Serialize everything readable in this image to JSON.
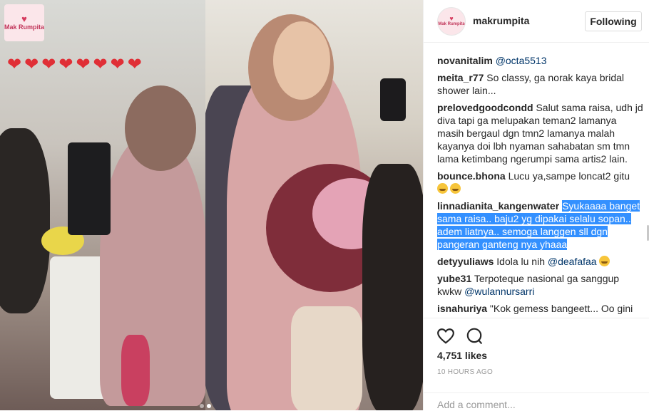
{
  "media": {
    "watermark_text": "Mak Rumpita",
    "hearts": [
      "❤",
      "❤",
      "❤",
      "❤",
      "❤",
      "❤",
      "❤",
      "❤"
    ],
    "carousel": {
      "count": 2,
      "active": 1
    }
  },
  "header": {
    "avatar_text": "Mak Rumpita",
    "username": "makrumpita",
    "follow_label": "Following"
  },
  "comments": [
    {
      "user": "novanitalim",
      "parts": [
        {
          "t": "mention",
          "v": "@octa5513"
        }
      ]
    },
    {
      "user": "meita_r77",
      "parts": [
        {
          "t": "text",
          "v": "So classy, ga norak kaya bridal shower lain..."
        }
      ]
    },
    {
      "user": "prelovedgoodcondd",
      "parts": [
        {
          "t": "text",
          "v": "Salut sama raisa, udh jd diva tapi ga melupakan teman2 lamanya masih bergaul dgn tmn2 lamanya malah kayanya doi lbh nyaman sahabatan sm tmn lama ketimbang ngerumpi sama artis2 lain."
        }
      ]
    },
    {
      "user": "bounce.bhona",
      "parts": [
        {
          "t": "text",
          "v": "Lucu ya,sampe loncat2 gitu"
        }
      ],
      "emoji": 2
    },
    {
      "user": "linnadianita_kangenwater",
      "parts": [
        {
          "t": "hl",
          "v": "Syukaaaa banget sama raisa.. baju2 yg dipakai selalu sopan.. adem liatnya.. semoga langgen sll dgn pangeran ganteng nya yhaaa"
        }
      ]
    },
    {
      "user": "detyyuliaws",
      "parts": [
        {
          "t": "text",
          "v": "Idola lu nih "
        },
        {
          "t": "mention",
          "v": "@deafafaa"
        }
      ],
      "emoji_after": 1
    },
    {
      "user": "yube31",
      "parts": [
        {
          "t": "text",
          "v": "Terpoteque nasional ga sanggup kwkw "
        },
        {
          "t": "mention",
          "v": "@wulannursarri"
        }
      ]
    },
    {
      "user": "isnahuriya",
      "parts": [
        {
          "t": "text",
          "v": "\"Kok gemess bangeett... Oo gini"
        }
      ]
    }
  ],
  "actions": {
    "like_icon": "heart-outline-icon",
    "comment_icon": "speech-bubble-icon",
    "likes_text": "4,751 likes",
    "time_text": "10 HOURS AGO"
  },
  "add_comment": {
    "placeholder": "Add a comment..."
  },
  "colors": {
    "accent_highlight": "#3390ff",
    "mention": "#003569",
    "border": "#efefef"
  }
}
